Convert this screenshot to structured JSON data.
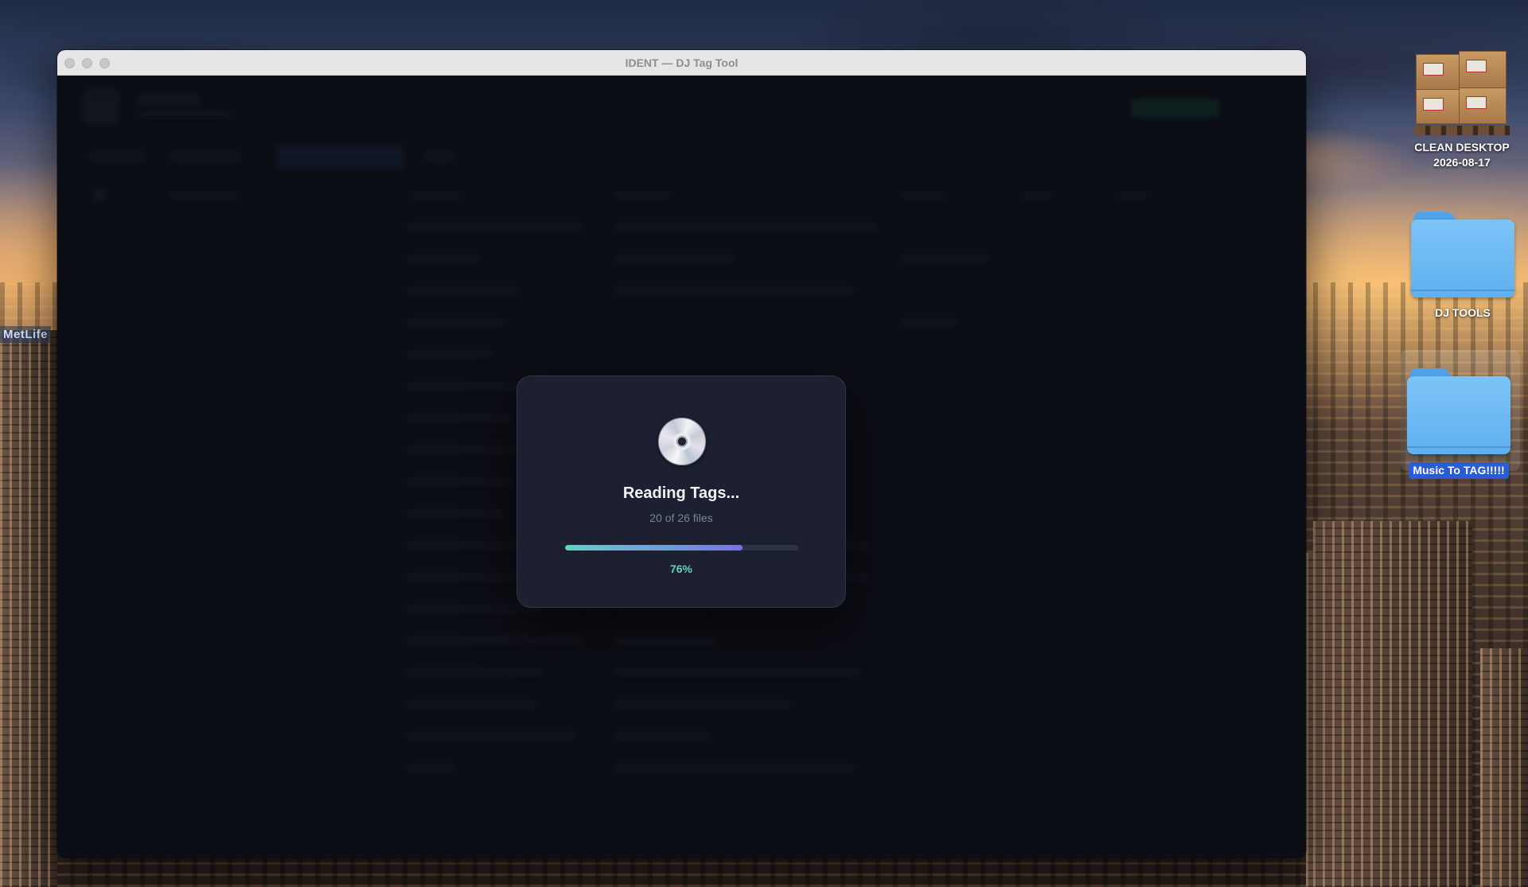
{
  "window": {
    "title": "IDENT — DJ Tag Tool"
  },
  "desktop": {
    "wallpaper_sign": "MetLife",
    "icons": [
      {
        "label": "CLEAN DESKTOP\n2026-08-17",
        "icon": "boxes-on-pallet-icon",
        "selected": false
      },
      {
        "label": "DJ TOOLS",
        "icon": "folder-icon",
        "selected": false
      },
      {
        "label": "Music To TAG!!!!!",
        "icon": "folder-icon",
        "selected": true
      }
    ]
  },
  "modal": {
    "icon": "compact-disc-icon",
    "title": "Reading Tags...",
    "subtitle": "20 of 26 files",
    "progress": 0.76,
    "progress_label": "76%",
    "progress_colors": {
      "start": "#5fd3c6",
      "end": "#7b6ff0"
    }
  },
  "colors": {
    "accent": "#5fd3c6",
    "app_background": "#13161d",
    "modal_background": "#1c2030",
    "selection_blue": "#2a5cd6"
  }
}
